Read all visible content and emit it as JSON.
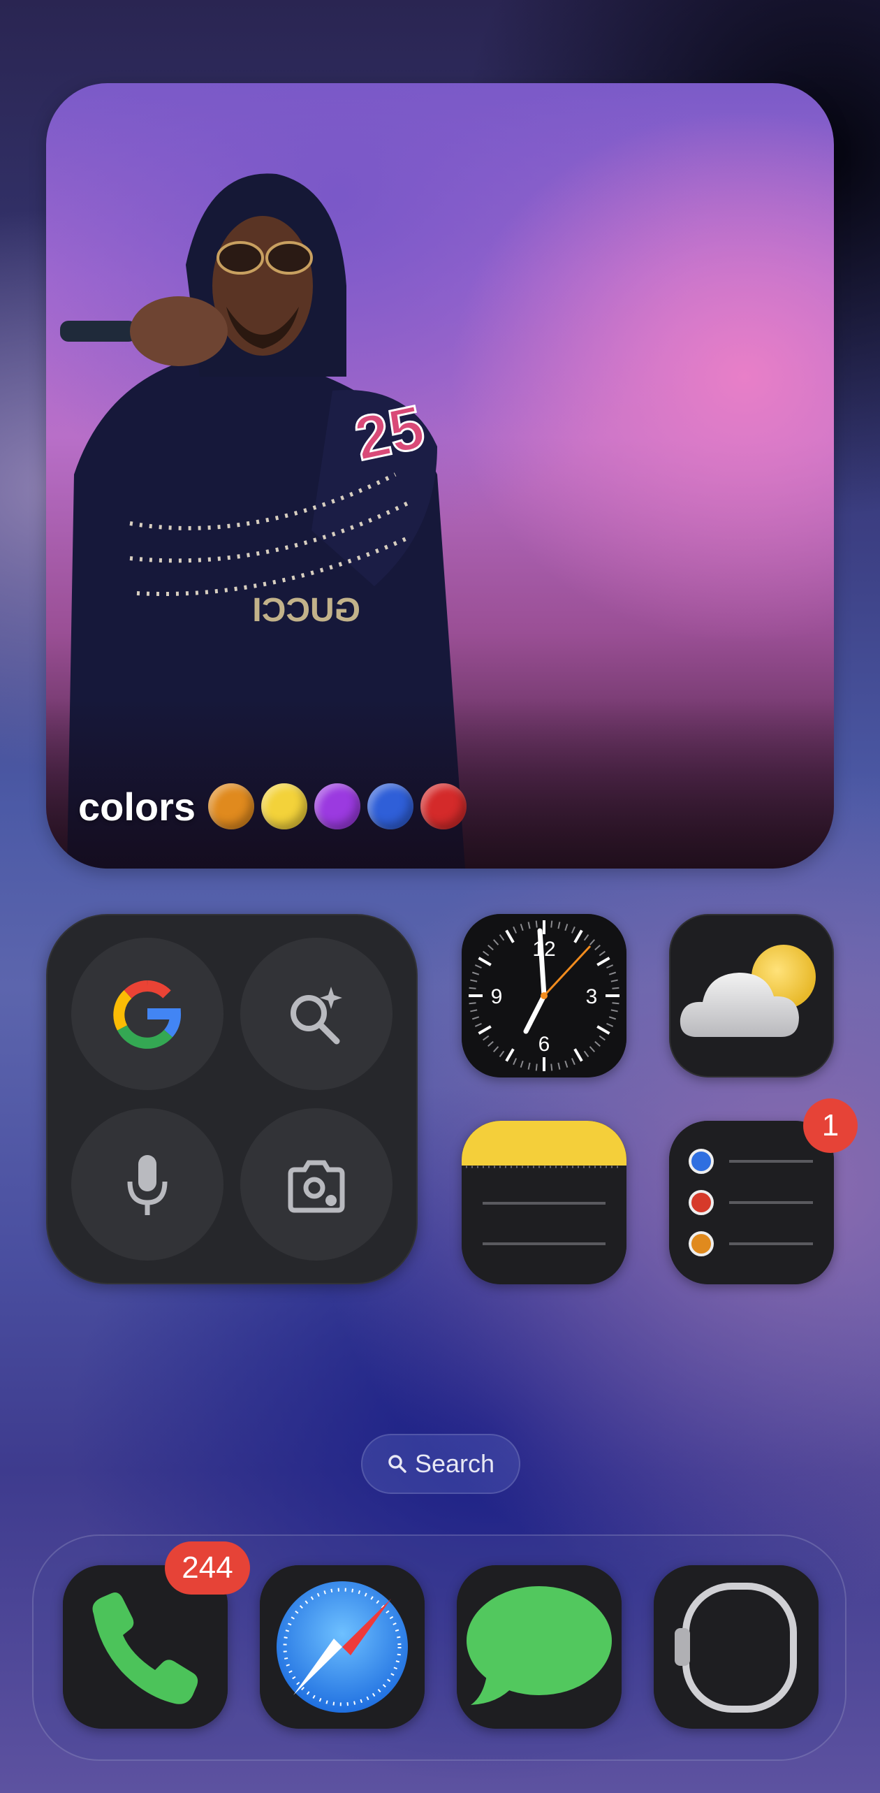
{
  "photo_widget": {
    "caption": "colors",
    "jersey_number": "25",
    "shirt_text": "GUCCI",
    "color_dots": [
      "#e08a1e",
      "#f3d23a",
      "#9b3ae0",
      "#2f5fd8",
      "#d42a2a"
    ]
  },
  "google_widget": {
    "buttons": [
      "google-logo-icon",
      "ai-search-icon",
      "microphone-icon",
      "google-lens-icon"
    ]
  },
  "apps": {
    "clock": {
      "numbers": [
        "12",
        "3",
        "6",
        "9"
      ]
    },
    "weather": {},
    "notes": {},
    "reminders": {
      "badge": "1"
    }
  },
  "search": {
    "label": "Search"
  },
  "dock": {
    "phone": {
      "badge": "244"
    },
    "safari": {},
    "messages": {},
    "watch": {}
  }
}
